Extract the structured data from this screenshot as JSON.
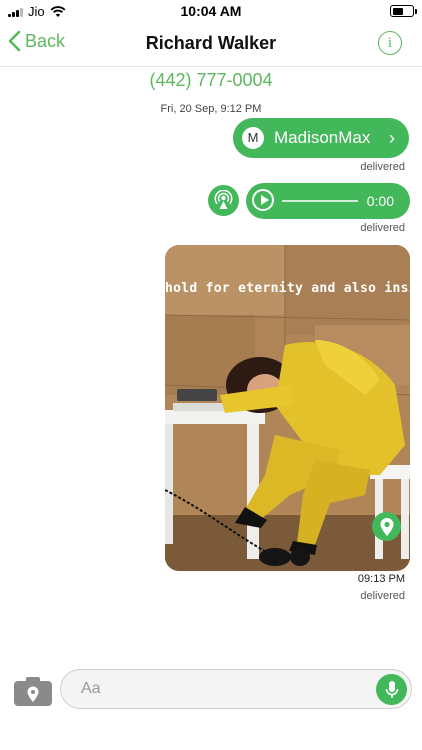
{
  "status_bar": {
    "carrier": "Jio",
    "time": "10:04 AM",
    "battery_level": 0.62
  },
  "nav": {
    "back_label": "Back",
    "title": "Richard Walker",
    "info_glyph": "i"
  },
  "conversation": {
    "phone_number": "(442) 777-0004",
    "date": "Fri, 20 Sep, 9:12 PM",
    "messages": [
      {
        "type": "contact",
        "avatar_initial": "M",
        "name": "MadisonMax",
        "chevron": "›",
        "status": "delivered"
      },
      {
        "type": "audio",
        "duration": "0:00",
        "status": "delivered",
        "icon": "live-broadcast-icon"
      },
      {
        "type": "photo",
        "caption": "hold for eternity and also inside",
        "time": "09:13 PM",
        "status": "delivered",
        "icon": "location-pin-icon"
      }
    ]
  },
  "composer": {
    "placeholder": "Aa",
    "camera_icon": "camera-location-icon",
    "mic_icon": "microphone-icon"
  },
  "colors": {
    "accent": "#5cb85c",
    "bubble": "#43b85a"
  }
}
